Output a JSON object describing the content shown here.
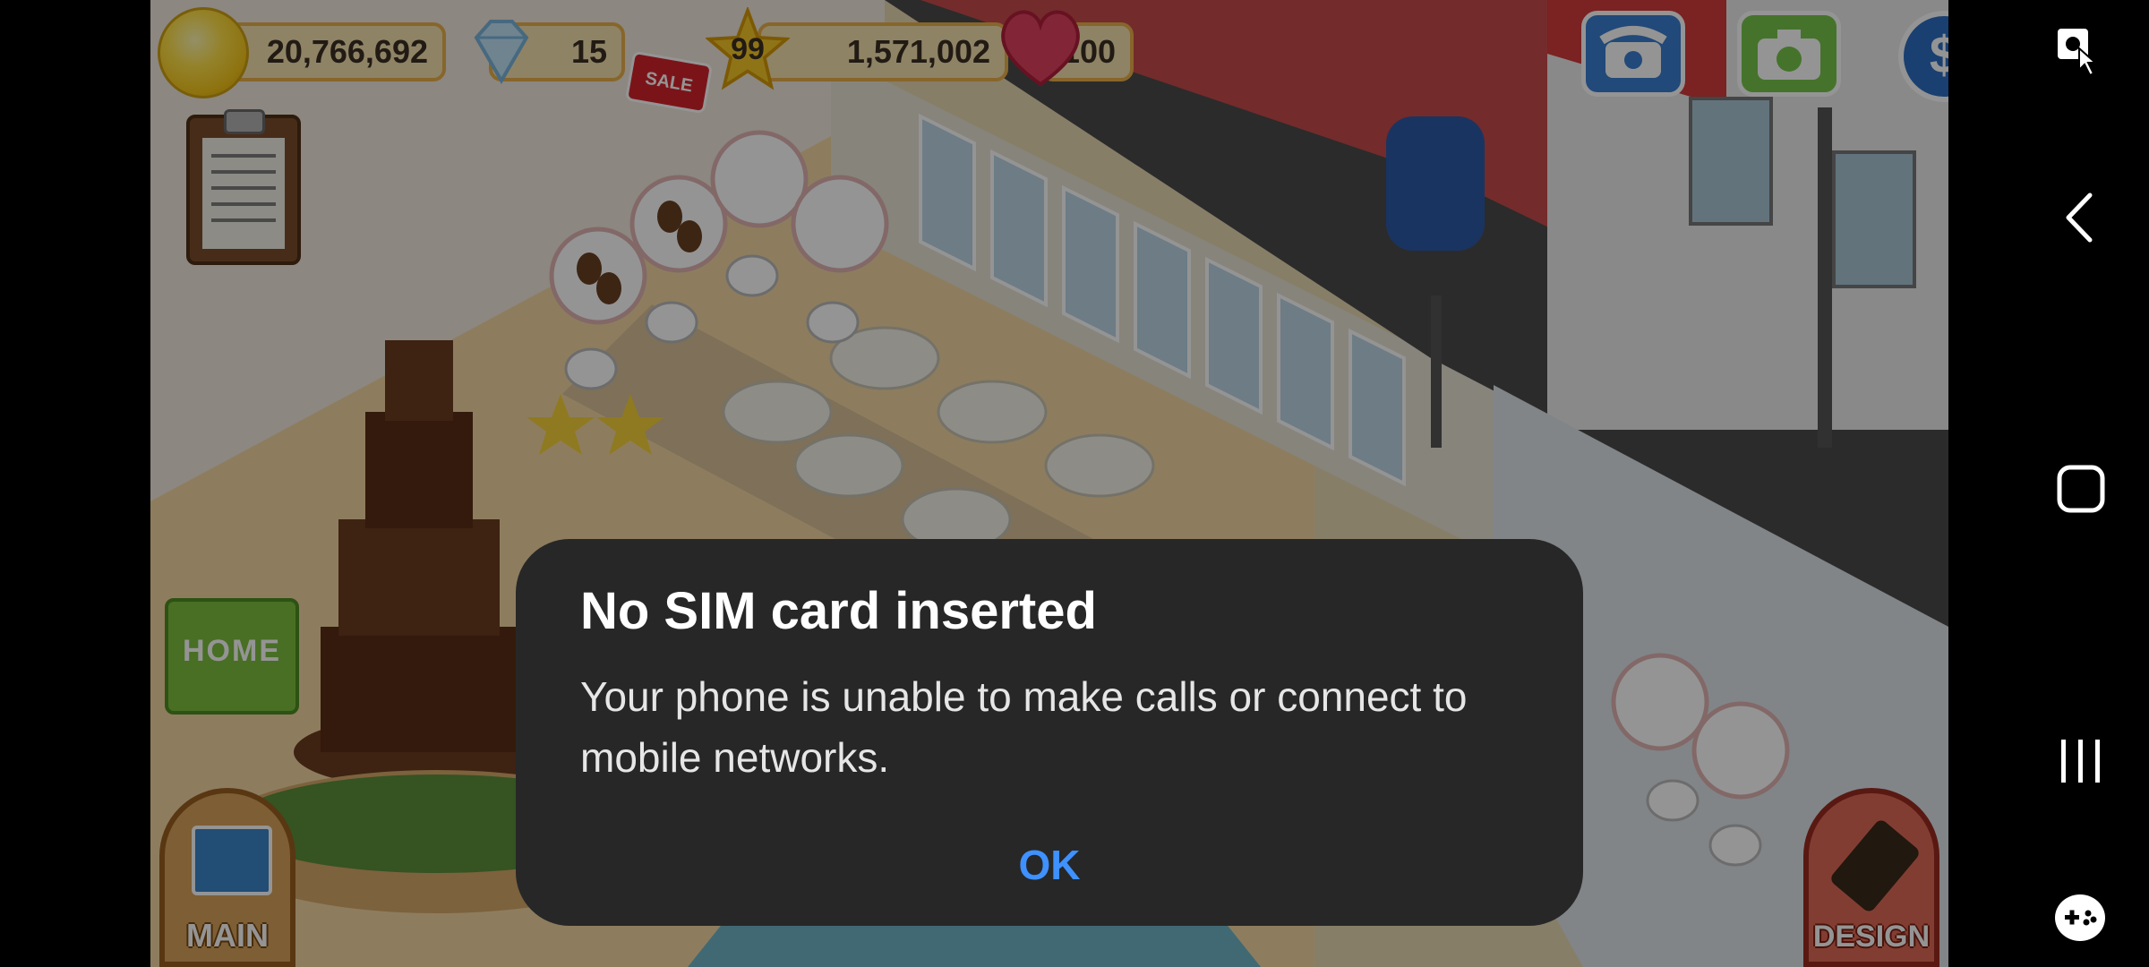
{
  "game": {
    "hud": {
      "coins": "20,766,692",
      "gems": "15",
      "sale_tag": "SALE",
      "star_level": "99",
      "star_points": "1,571,002",
      "hearts": "100",
      "money_symbol": "$"
    },
    "buttons": {
      "home": "HOME",
      "main": "MAIN",
      "design": "DESIGN"
    },
    "icons": [
      "coin-icon",
      "gem-icon",
      "star-icon",
      "heart-icon",
      "phone-icon",
      "camera-icon",
      "money-icon",
      "clipboard-icon"
    ]
  },
  "dialog": {
    "title": "No SIM card inserted",
    "message": "Your phone is unable to make calls or connect to mobile networks.",
    "ok_label": "OK",
    "accent_color": "#3e91ff"
  },
  "navbar": {
    "icons": [
      "screen-pin-icon",
      "back-icon",
      "home-icon",
      "recents-icon",
      "game-tools-icon"
    ]
  }
}
